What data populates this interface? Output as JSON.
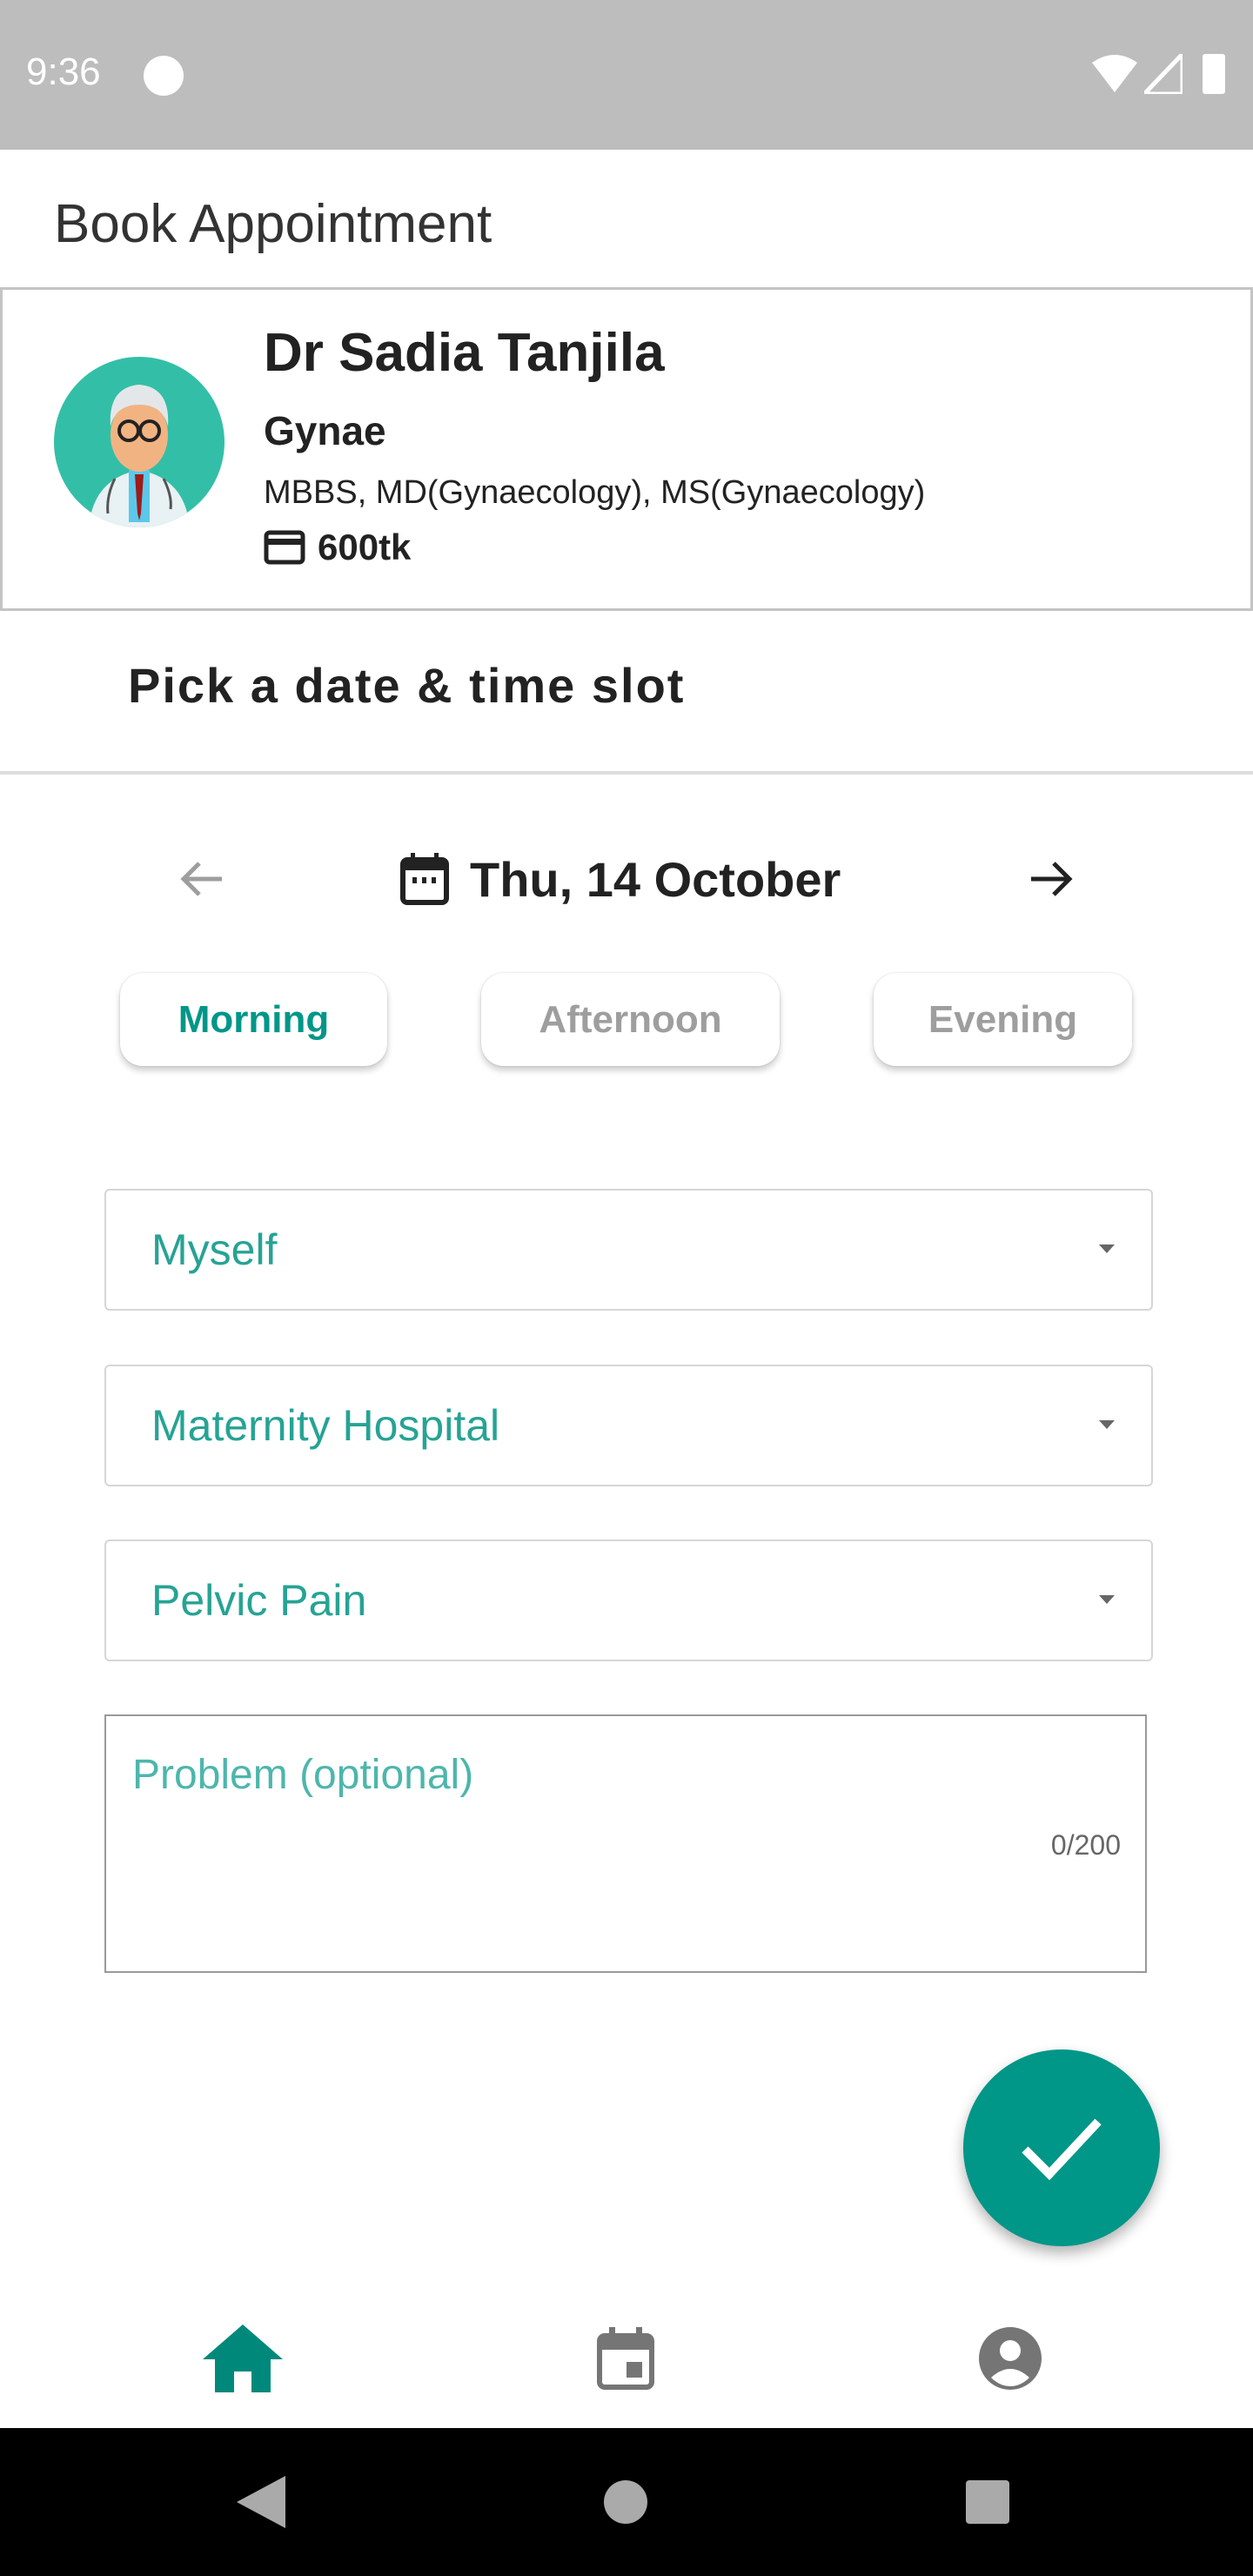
{
  "status_bar": {
    "time": "9:36"
  },
  "header": {
    "title": "Book Appointment"
  },
  "doctor": {
    "name": "Dr Sadia Tanjila",
    "specialty": "Gynae",
    "degrees": "MBBS, MD(Gynaecology), MS(Gynaecology)",
    "fee": "600tk"
  },
  "section": {
    "title": "Pick a date & time slot"
  },
  "date_picker": {
    "date": "Thu, 14 October"
  },
  "time_slots": [
    {
      "label": "Morning",
      "selected": true
    },
    {
      "label": "Afternoon",
      "selected": false
    },
    {
      "label": "Evening",
      "selected": false
    }
  ],
  "form": {
    "patient": "Myself",
    "hospital": "Maternity Hospital",
    "reason": "Pelvic Pain",
    "problem_placeholder": "Problem (optional)",
    "problem_counter": "0/200"
  },
  "colors": {
    "accent": "#009688",
    "status_bar": "#bdbdbd"
  }
}
